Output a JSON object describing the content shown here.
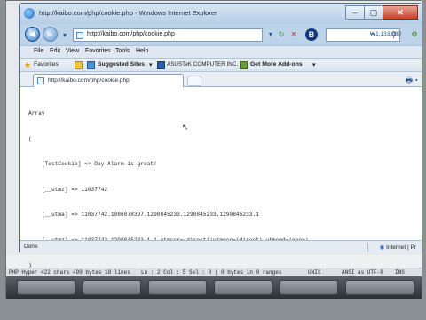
{
  "window": {
    "title": "http://kaibo.com/php/cookie.php - Windows Internet Explorer",
    "minimize": "–",
    "maximize": "▢",
    "close": "✕"
  },
  "nav": {
    "back_icon": "back-arrow-icon",
    "forward_icon": "forward-arrow-icon",
    "address": "http://kaibo.com/php/cookie.php",
    "rate_text": "₩1,133,980"
  },
  "menu": {
    "items": [
      "File",
      "Edit",
      "View",
      "Favorites",
      "Tools",
      "Help"
    ]
  },
  "favorites": {
    "favorites_label": "Favorites",
    "suggested_sites": "Suggested Sites",
    "asus_link": "ASUSTeK COMPUTER INC.",
    "addons": "Get More Add-ons"
  },
  "tab": {
    "label": "http://kaibo.com/php/cookie.php"
  },
  "content": {
    "lines": [
      "Array",
      "(",
      "    [TestCookie] => Day Alarm is great!",
      "    [__utmz] => 11037742",
      "    [__utma] => 11037742.1086078397.1290845233.1290845233.1290845233.1",
      "    [__utmz] => 11037742.1290845233.1.1.utmcsr=(direct)|utmccn=(direct)|utmcmd=(none)",
      ")"
    ]
  },
  "status": {
    "left": "Done",
    "zone": "Internet | Pr"
  },
  "editor_status": {
    "file_info": "PHP Hyper 422 chars 499 bytes 18 lines",
    "position": "Ln : 2   Col : 5   Sel : 0 | 0 bytes in 0 ranges",
    "line_ending": "UNIX",
    "encoding": "ANSI as UTF-8",
    "mode": "INS"
  }
}
